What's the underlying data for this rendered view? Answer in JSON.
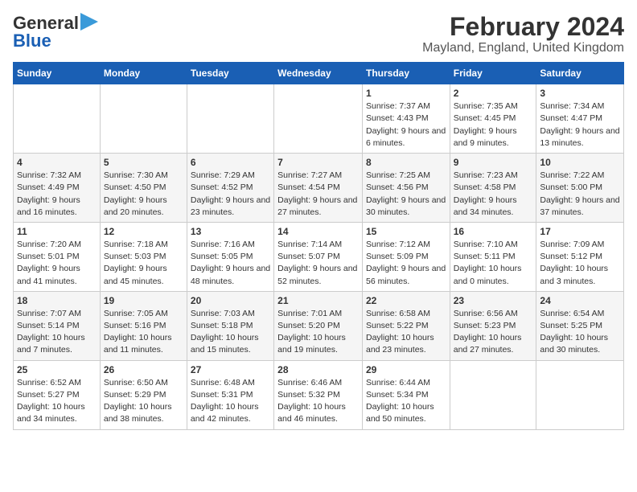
{
  "logo": {
    "line1": "General",
    "line2": "Blue"
  },
  "title": "February 2024",
  "subtitle": "Mayland, England, United Kingdom",
  "days_of_week": [
    "Sunday",
    "Monday",
    "Tuesday",
    "Wednesday",
    "Thursday",
    "Friday",
    "Saturday"
  ],
  "weeks": [
    [
      {
        "day": "",
        "info": ""
      },
      {
        "day": "",
        "info": ""
      },
      {
        "day": "",
        "info": ""
      },
      {
        "day": "",
        "info": ""
      },
      {
        "day": "1",
        "info": "Sunrise: 7:37 AM\nSunset: 4:43 PM\nDaylight: 9 hours and 6 minutes."
      },
      {
        "day": "2",
        "info": "Sunrise: 7:35 AM\nSunset: 4:45 PM\nDaylight: 9 hours and 9 minutes."
      },
      {
        "day": "3",
        "info": "Sunrise: 7:34 AM\nSunset: 4:47 PM\nDaylight: 9 hours and 13 minutes."
      }
    ],
    [
      {
        "day": "4",
        "info": "Sunrise: 7:32 AM\nSunset: 4:49 PM\nDaylight: 9 hours and 16 minutes."
      },
      {
        "day": "5",
        "info": "Sunrise: 7:30 AM\nSunset: 4:50 PM\nDaylight: 9 hours and 20 minutes."
      },
      {
        "day": "6",
        "info": "Sunrise: 7:29 AM\nSunset: 4:52 PM\nDaylight: 9 hours and 23 minutes."
      },
      {
        "day": "7",
        "info": "Sunrise: 7:27 AM\nSunset: 4:54 PM\nDaylight: 9 hours and 27 minutes."
      },
      {
        "day": "8",
        "info": "Sunrise: 7:25 AM\nSunset: 4:56 PM\nDaylight: 9 hours and 30 minutes."
      },
      {
        "day": "9",
        "info": "Sunrise: 7:23 AM\nSunset: 4:58 PM\nDaylight: 9 hours and 34 minutes."
      },
      {
        "day": "10",
        "info": "Sunrise: 7:22 AM\nSunset: 5:00 PM\nDaylight: 9 hours and 37 minutes."
      }
    ],
    [
      {
        "day": "11",
        "info": "Sunrise: 7:20 AM\nSunset: 5:01 PM\nDaylight: 9 hours and 41 minutes."
      },
      {
        "day": "12",
        "info": "Sunrise: 7:18 AM\nSunset: 5:03 PM\nDaylight: 9 hours and 45 minutes."
      },
      {
        "day": "13",
        "info": "Sunrise: 7:16 AM\nSunset: 5:05 PM\nDaylight: 9 hours and 48 minutes."
      },
      {
        "day": "14",
        "info": "Sunrise: 7:14 AM\nSunset: 5:07 PM\nDaylight: 9 hours and 52 minutes."
      },
      {
        "day": "15",
        "info": "Sunrise: 7:12 AM\nSunset: 5:09 PM\nDaylight: 9 hours and 56 minutes."
      },
      {
        "day": "16",
        "info": "Sunrise: 7:10 AM\nSunset: 5:11 PM\nDaylight: 10 hours and 0 minutes."
      },
      {
        "day": "17",
        "info": "Sunrise: 7:09 AM\nSunset: 5:12 PM\nDaylight: 10 hours and 3 minutes."
      }
    ],
    [
      {
        "day": "18",
        "info": "Sunrise: 7:07 AM\nSunset: 5:14 PM\nDaylight: 10 hours and 7 minutes."
      },
      {
        "day": "19",
        "info": "Sunrise: 7:05 AM\nSunset: 5:16 PM\nDaylight: 10 hours and 11 minutes."
      },
      {
        "day": "20",
        "info": "Sunrise: 7:03 AM\nSunset: 5:18 PM\nDaylight: 10 hours and 15 minutes."
      },
      {
        "day": "21",
        "info": "Sunrise: 7:01 AM\nSunset: 5:20 PM\nDaylight: 10 hours and 19 minutes."
      },
      {
        "day": "22",
        "info": "Sunrise: 6:58 AM\nSunset: 5:22 PM\nDaylight: 10 hours and 23 minutes."
      },
      {
        "day": "23",
        "info": "Sunrise: 6:56 AM\nSunset: 5:23 PM\nDaylight: 10 hours and 27 minutes."
      },
      {
        "day": "24",
        "info": "Sunrise: 6:54 AM\nSunset: 5:25 PM\nDaylight: 10 hours and 30 minutes."
      }
    ],
    [
      {
        "day": "25",
        "info": "Sunrise: 6:52 AM\nSunset: 5:27 PM\nDaylight: 10 hours and 34 minutes."
      },
      {
        "day": "26",
        "info": "Sunrise: 6:50 AM\nSunset: 5:29 PM\nDaylight: 10 hours and 38 minutes."
      },
      {
        "day": "27",
        "info": "Sunrise: 6:48 AM\nSunset: 5:31 PM\nDaylight: 10 hours and 42 minutes."
      },
      {
        "day": "28",
        "info": "Sunrise: 6:46 AM\nSunset: 5:32 PM\nDaylight: 10 hours and 46 minutes."
      },
      {
        "day": "29",
        "info": "Sunrise: 6:44 AM\nSunset: 5:34 PM\nDaylight: 10 hours and 50 minutes."
      },
      {
        "day": "",
        "info": ""
      },
      {
        "day": "",
        "info": ""
      }
    ]
  ]
}
